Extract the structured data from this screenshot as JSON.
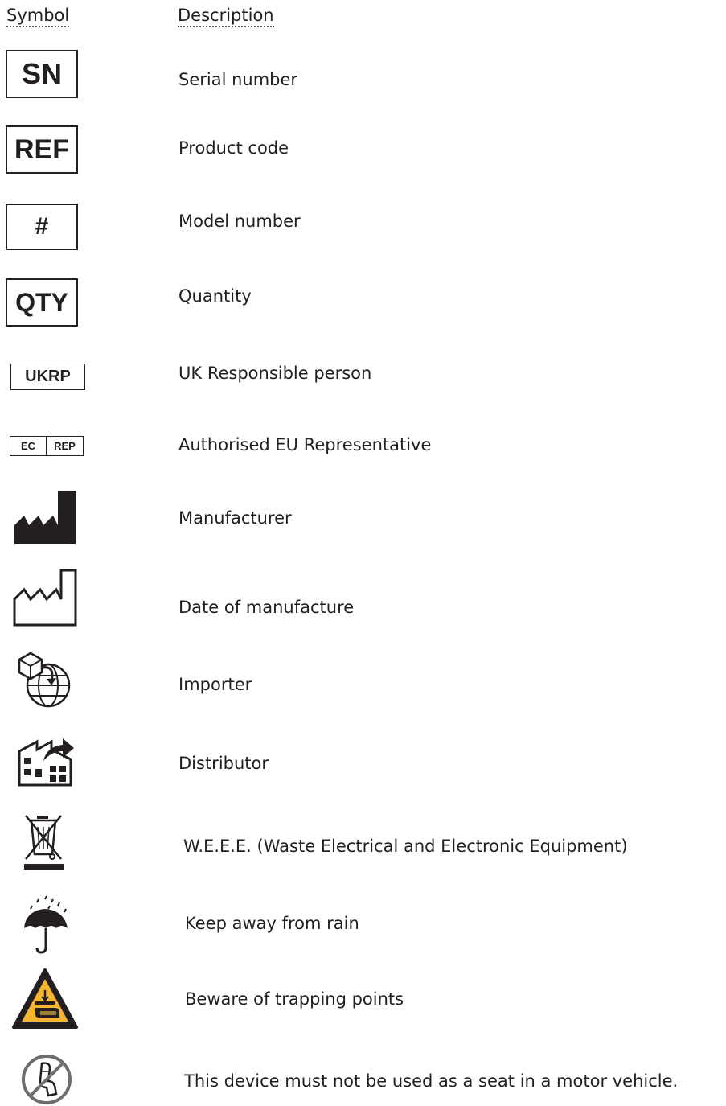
{
  "header": {
    "symbol": "Symbol",
    "description": "Description"
  },
  "rows": [
    {
      "symbol_text": "SN",
      "symbol_icon": "serial-number-box",
      "description": "Serial number"
    },
    {
      "symbol_text": "REF",
      "symbol_icon": "reference-box",
      "description": "Product code"
    },
    {
      "symbol_text": "#",
      "symbol_icon": "model-number-box",
      "description": "Model number"
    },
    {
      "symbol_text": "QTY",
      "symbol_icon": "quantity-box",
      "description": "Quantity"
    },
    {
      "symbol_text": "UKRP",
      "symbol_icon": "ukrp-box",
      "description": "UK Responsible person"
    },
    {
      "symbol_text_left": "EC",
      "symbol_text_right": "REP",
      "symbol_icon": "ec-rep-box",
      "description": "Authorised  EU Representative"
    },
    {
      "symbol_icon": "manufacturer-icon",
      "description": "Manufacturer"
    },
    {
      "symbol_icon": "date-of-manufacture-icon",
      "description": "Date of manufacture"
    },
    {
      "symbol_icon": "importer-icon",
      "description": "Importer"
    },
    {
      "symbol_icon": "distributor-icon",
      "description": "Distributor"
    },
    {
      "symbol_icon": "weee-icon",
      "description": "W.E.E.E. (Waste Electrical and Electronic Equipment)"
    },
    {
      "symbol_icon": "keep-away-from-rain-icon",
      "description": "Keep away from rain"
    },
    {
      "symbol_icon": "trapping-points-warning-icon",
      "description": "Beware of trapping points"
    },
    {
      "symbol_icon": "no-motor-vehicle-seat-icon",
      "description": "This device must not be used as a seat in a motor vehicle."
    }
  ]
}
